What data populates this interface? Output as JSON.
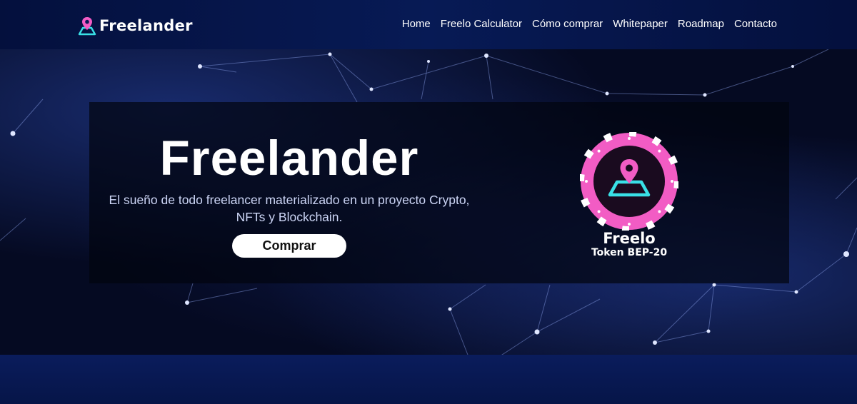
{
  "header": {
    "brand": "Freelander",
    "logo_icon": "map-pin-icon",
    "nav": [
      {
        "label": "Home"
      },
      {
        "label": "Freelo Calculator"
      },
      {
        "label": "Cómo comprar"
      },
      {
        "label": "Whitepaper"
      },
      {
        "label": "Roadmap"
      },
      {
        "label": "Contacto"
      }
    ]
  },
  "hero": {
    "title": "Freelander",
    "subtitle": "El sueño de todo freelancer materializado en un proyecto Crypto, NFTs y Blockchain.",
    "button_label": "Comprar"
  },
  "token": {
    "name": "Freelo",
    "standard": "Token BEP-20",
    "icon": "map-pin-coin-icon"
  },
  "colors": {
    "accent_pink": "#f25cc4",
    "accent_cyan": "#39e0e6",
    "navy": "#071a55"
  }
}
